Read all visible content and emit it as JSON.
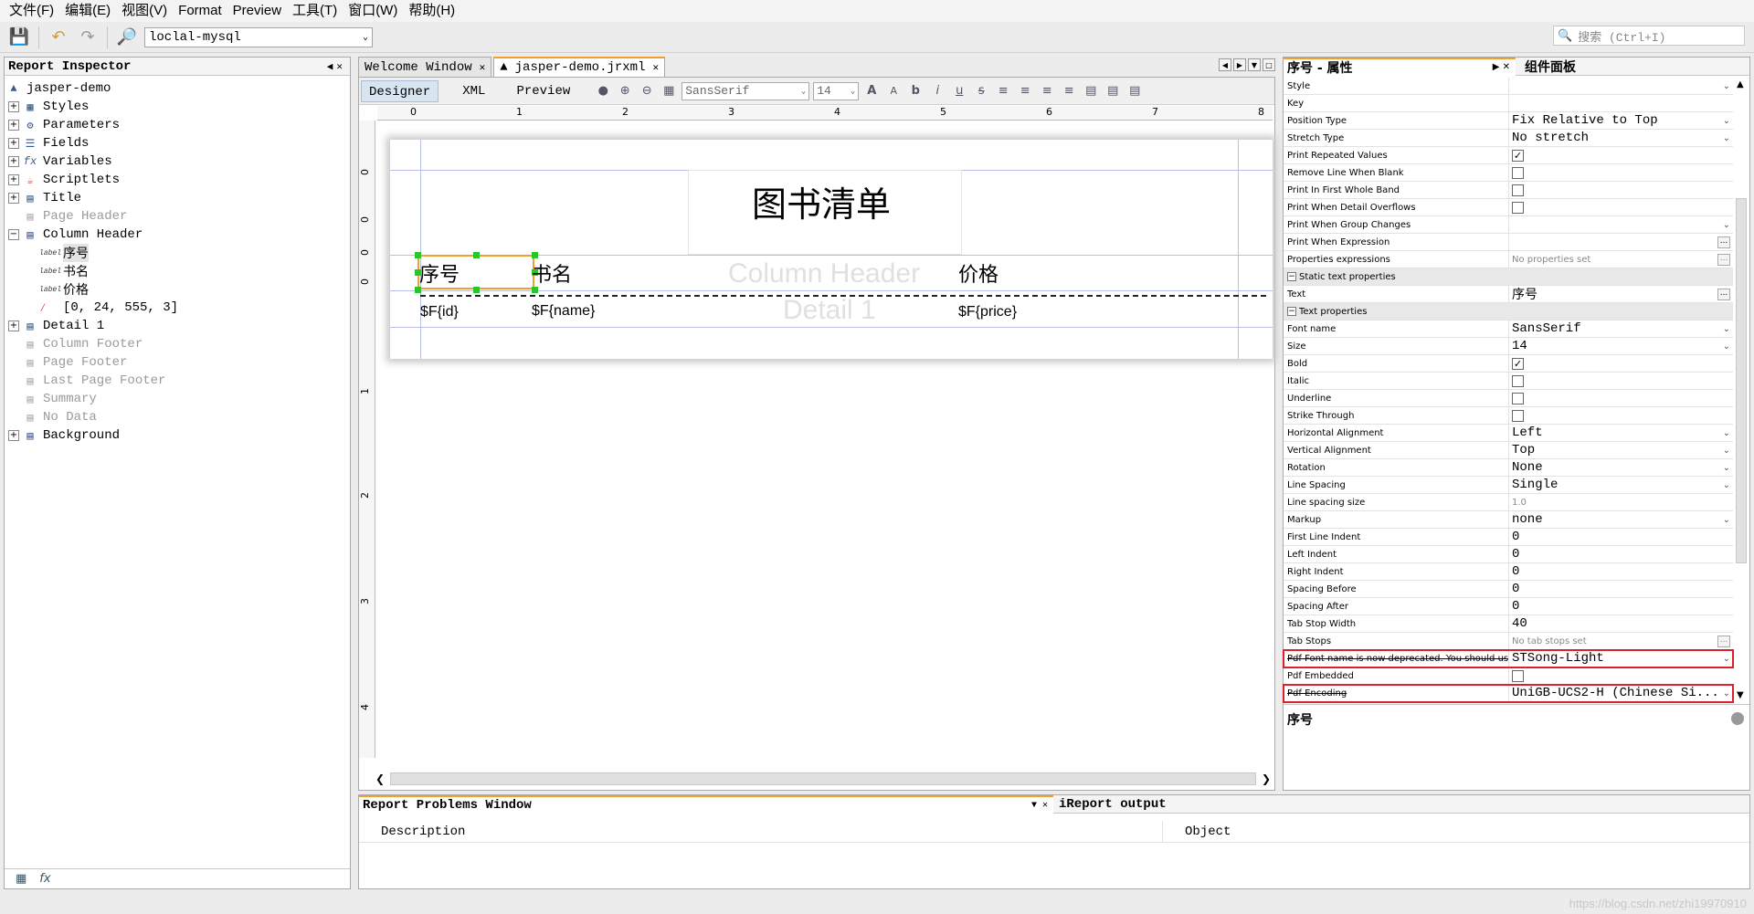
{
  "menu": [
    "文件(F)",
    "编辑(E)",
    "视图(V)",
    "Format",
    "Preview",
    "工具(T)",
    "窗口(W)",
    "帮助(H)"
  ],
  "toolbar": {
    "connection": "loclal-mysql",
    "search_placeholder": "搜索 (Ctrl+I)"
  },
  "inspector": {
    "title": "Report Inspector",
    "root": "jasper-demo",
    "items": [
      {
        "label": "Styles"
      },
      {
        "label": "Parameters"
      },
      {
        "label": "Fields"
      },
      {
        "label": "Variables"
      },
      {
        "label": "Scriptlets"
      },
      {
        "label": "Title"
      },
      {
        "label": "Page Header"
      },
      {
        "label": "Column Header"
      },
      {
        "label": "序号"
      },
      {
        "label": "书名"
      },
      {
        "label": "价格"
      },
      {
        "label": "[0, 24, 555, 3]"
      },
      {
        "label": "Detail 1"
      },
      {
        "label": "Column Footer"
      },
      {
        "label": "Page Footer"
      },
      {
        "label": "Last Page Footer"
      },
      {
        "label": "Summary"
      },
      {
        "label": "No Data"
      },
      {
        "label": "Background"
      }
    ]
  },
  "tabs": {
    "welcome": "Welcome Window",
    "doc": "jasper-demo.jrxml"
  },
  "editor": {
    "modes": [
      "Designer",
      "XML",
      "Preview"
    ],
    "font": "SansSerif",
    "size": "14",
    "ruler": [
      "0",
      "1",
      "2",
      "3",
      "4",
      "5",
      "6",
      "7",
      "8"
    ],
    "ruler_left": [
      "0",
      "0",
      "0",
      "0",
      "1",
      "2",
      "3",
      "4"
    ]
  },
  "report": {
    "title": "图书清单",
    "col1": "序号",
    "col2": "书名",
    "col3": "价格",
    "band_column": "Column Header",
    "band_detail": "Detail 1",
    "f1": "$F{id}",
    "f2": "$F{name}",
    "f3": "$F{price}"
  },
  "props": {
    "title": "序号 - 属性",
    "palette": "组件面板",
    "r01": "Style",
    "r02": "Key",
    "r03": "Position Type",
    "r03v": "Fix Relative to Top",
    "r04": "Stretch Type",
    "r04v": "No stretch",
    "r05": "Print Repeated Values",
    "r06": "Remove Line When Blank",
    "r07": "Print In First Whole Band",
    "r08": "Print When Detail Overflows",
    "r09": "Print When Group Changes",
    "r10": "Print When Expression",
    "r11": "Properties expressions",
    "r11v": "No properties set",
    "s1": "Static text properties",
    "r12": "Text",
    "r12v": "序号",
    "s2": "Text properties",
    "r13": "Font name",
    "r13v": "SansSerif",
    "r14": "Size",
    "r14v": "14",
    "r15": "Bold",
    "r16": "Italic",
    "r17": "Underline",
    "r18": "Strike Through",
    "r19": "Horizontal Alignment",
    "r19v": "Left",
    "r20": "Vertical Alignment",
    "r20v": "Top",
    "r21": "Rotation",
    "r21v": "None",
    "r22": "Line Spacing",
    "r22v": "Single",
    "r23": "Line spacing size",
    "r23v": "1.0",
    "r24": "Markup",
    "r24v": "none",
    "r25": "First Line Indent",
    "r25v": "0",
    "r26": "Left Indent",
    "r26v": "0",
    "r27": "Right Indent",
    "r27v": "0",
    "r28": "Spacing Before",
    "r28v": "0",
    "r29": "Spacing After",
    "r29v": "0",
    "r30": "Tab Stop Width",
    "r30v": "40",
    "r31": "Tab Stops",
    "r31v": "No tab stops set",
    "r32": "Pdf Font name is now deprecated. You should use",
    "r32v": "STSong-Light",
    "r33": "Pdf Embedded",
    "r34": "Pdf Encoding",
    "r34v": "UniGB-UCS2-H (Chinese Si...",
    "desc": "序号"
  },
  "bottom": {
    "problems": "Report Problems Window",
    "output": "iReport output",
    "col_desc": "Description",
    "col_obj": "Object"
  },
  "watermark": "https://blog.csdn.net/zhi19970910",
  "colors": {
    "accent": "#f0a030",
    "highlight": "#d9232a",
    "guide": "#b8bce8"
  }
}
